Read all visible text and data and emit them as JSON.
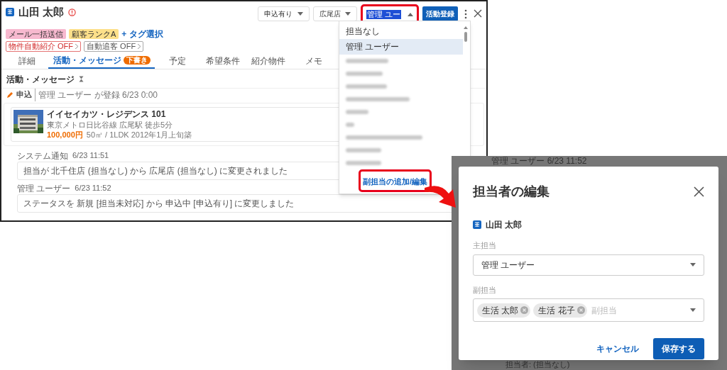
{
  "record": {
    "name": "山田 太郎",
    "tags": [
      {
        "label": "メール一括送信",
        "color": "#f7b9cf"
      },
      {
        "label": "顧客ランクA",
        "color": "#fde08a"
      }
    ],
    "tag_link": "+ タグ選択",
    "toggles": [
      {
        "label": "物件自動紹介 OFF",
        "kind": "warning"
      },
      {
        "label": "自動追客 OFF",
        "kind": "plain"
      }
    ]
  },
  "toolbar": {
    "status_select": "申込有り",
    "store_select": "広尾店",
    "assignee_select": {
      "value": "管理 ユー",
      "expanded": true
    },
    "register_button": "活動登録"
  },
  "tabs": [
    {
      "label": "詳細",
      "selected": false
    },
    {
      "label": "活動・メッセージ",
      "selected": true,
      "badge": "下書き"
    },
    {
      "label": "予定",
      "selected": false
    },
    {
      "label": "希望条件",
      "selected": false
    },
    {
      "label": "紹介物件",
      "selected": false
    },
    {
      "label": "メモ",
      "selected": false
    }
  ],
  "section_title": "活動・メッセージ",
  "activity": {
    "type": "申込",
    "meta": "管理 ユーザー が登録  6/23 0:00"
  },
  "property": {
    "name": "イイセイカツ・レジデンス 101",
    "access": "東京メトロ日比谷線 広尾駅 徒歩5分",
    "price": "100,000円",
    "details": "50㎡ / 1LDK  2012年1月上旬築"
  },
  "messages": [
    {
      "sender": "システム通知",
      "time": "6/23 11:51",
      "text": "担当が 北千住店 (担当なし) から 広尾店 (担当なし) に変更されました"
    },
    {
      "sender": "管理 ユーザー",
      "time": "6/23 11:52",
      "text": "ステータスを 新規 [担当未対応] から 申込中 [申込有り] に変更しました"
    }
  ],
  "assignee_menu": {
    "options": [
      {
        "label": "担当なし",
        "selected": false
      },
      {
        "label": "管理 ユーザー",
        "selected": true
      }
    ],
    "footer_link": "副担当の追加/編集"
  },
  "backdrop_texts": [
    "管理 ユーザー  6/23 11:52",
    "担当者: (担当なし)"
  ],
  "dialog": {
    "title": "担当者の編集",
    "customer": "山田 太郎",
    "main_label": "主担当",
    "main_value": "管理 ユーザー",
    "sub_label": "副担当",
    "sub_chips": [
      "生活 太郎",
      "生活 花子"
    ],
    "sub_placeholder": "副担当",
    "cancel": "キャンセル",
    "save": "保存する"
  }
}
